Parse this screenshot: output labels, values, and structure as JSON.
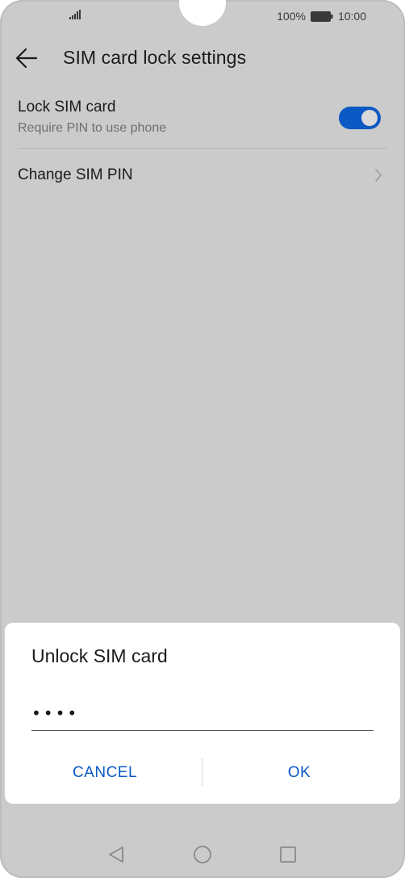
{
  "status_bar": {
    "battery_percent": "100%",
    "time": "10:00",
    "icons": [
      "signal-icon",
      "battery-icon"
    ]
  },
  "header": {
    "title": "SIM card lock settings",
    "back_icon": "arrow-left-icon"
  },
  "settings": {
    "lock_sim": {
      "title": "Lock SIM card",
      "subtitle": "Require PIN to use phone",
      "toggle_on": true
    },
    "change_pin": {
      "title": "Change SIM PIN"
    }
  },
  "dialog": {
    "title": "Unlock SIM card",
    "pin_value": "••••",
    "cancel_label": "CANCEL",
    "ok_label": "OK"
  },
  "nav_bar": {
    "icons": [
      "nav-back-icon",
      "nav-home-icon",
      "nav-recent-icon"
    ]
  },
  "colors": {
    "accent": "#0a59c4",
    "overlay_background": "#cbcbcb",
    "dialog_background": "#ffffff"
  }
}
